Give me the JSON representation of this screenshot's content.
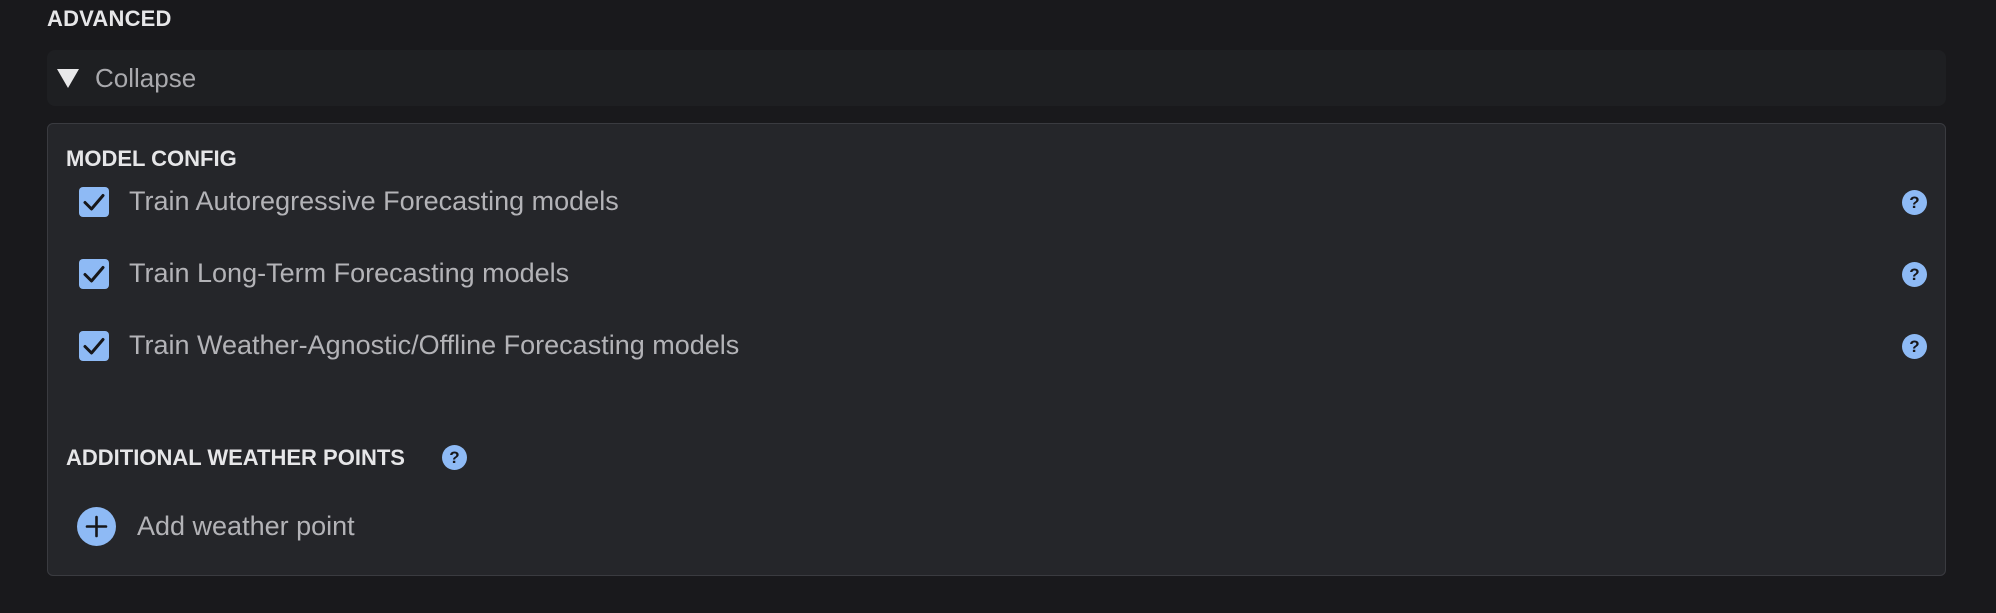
{
  "advanced": {
    "title": "ADVANCED",
    "collapse_label": "Collapse"
  },
  "model_config": {
    "title": "MODEL CONFIG",
    "options": [
      {
        "label": "Train Autoregressive Forecasting models",
        "checked": true
      },
      {
        "label": "Train Long-Term Forecasting models",
        "checked": true
      },
      {
        "label": "Train Weather-Agnostic/Offline Forecasting models",
        "checked": true
      }
    ]
  },
  "weather_points": {
    "title": "ADDITIONAL WEATHER POINTS",
    "add_label": "Add weather point"
  },
  "icons": {
    "help": "?",
    "collapse": "triangle-down-icon",
    "add": "plus-circle-icon",
    "check": "checkmark-icon"
  },
  "colors": {
    "background": "#19191c",
    "panel": "#25262a",
    "accent": "#8ebaf5"
  }
}
